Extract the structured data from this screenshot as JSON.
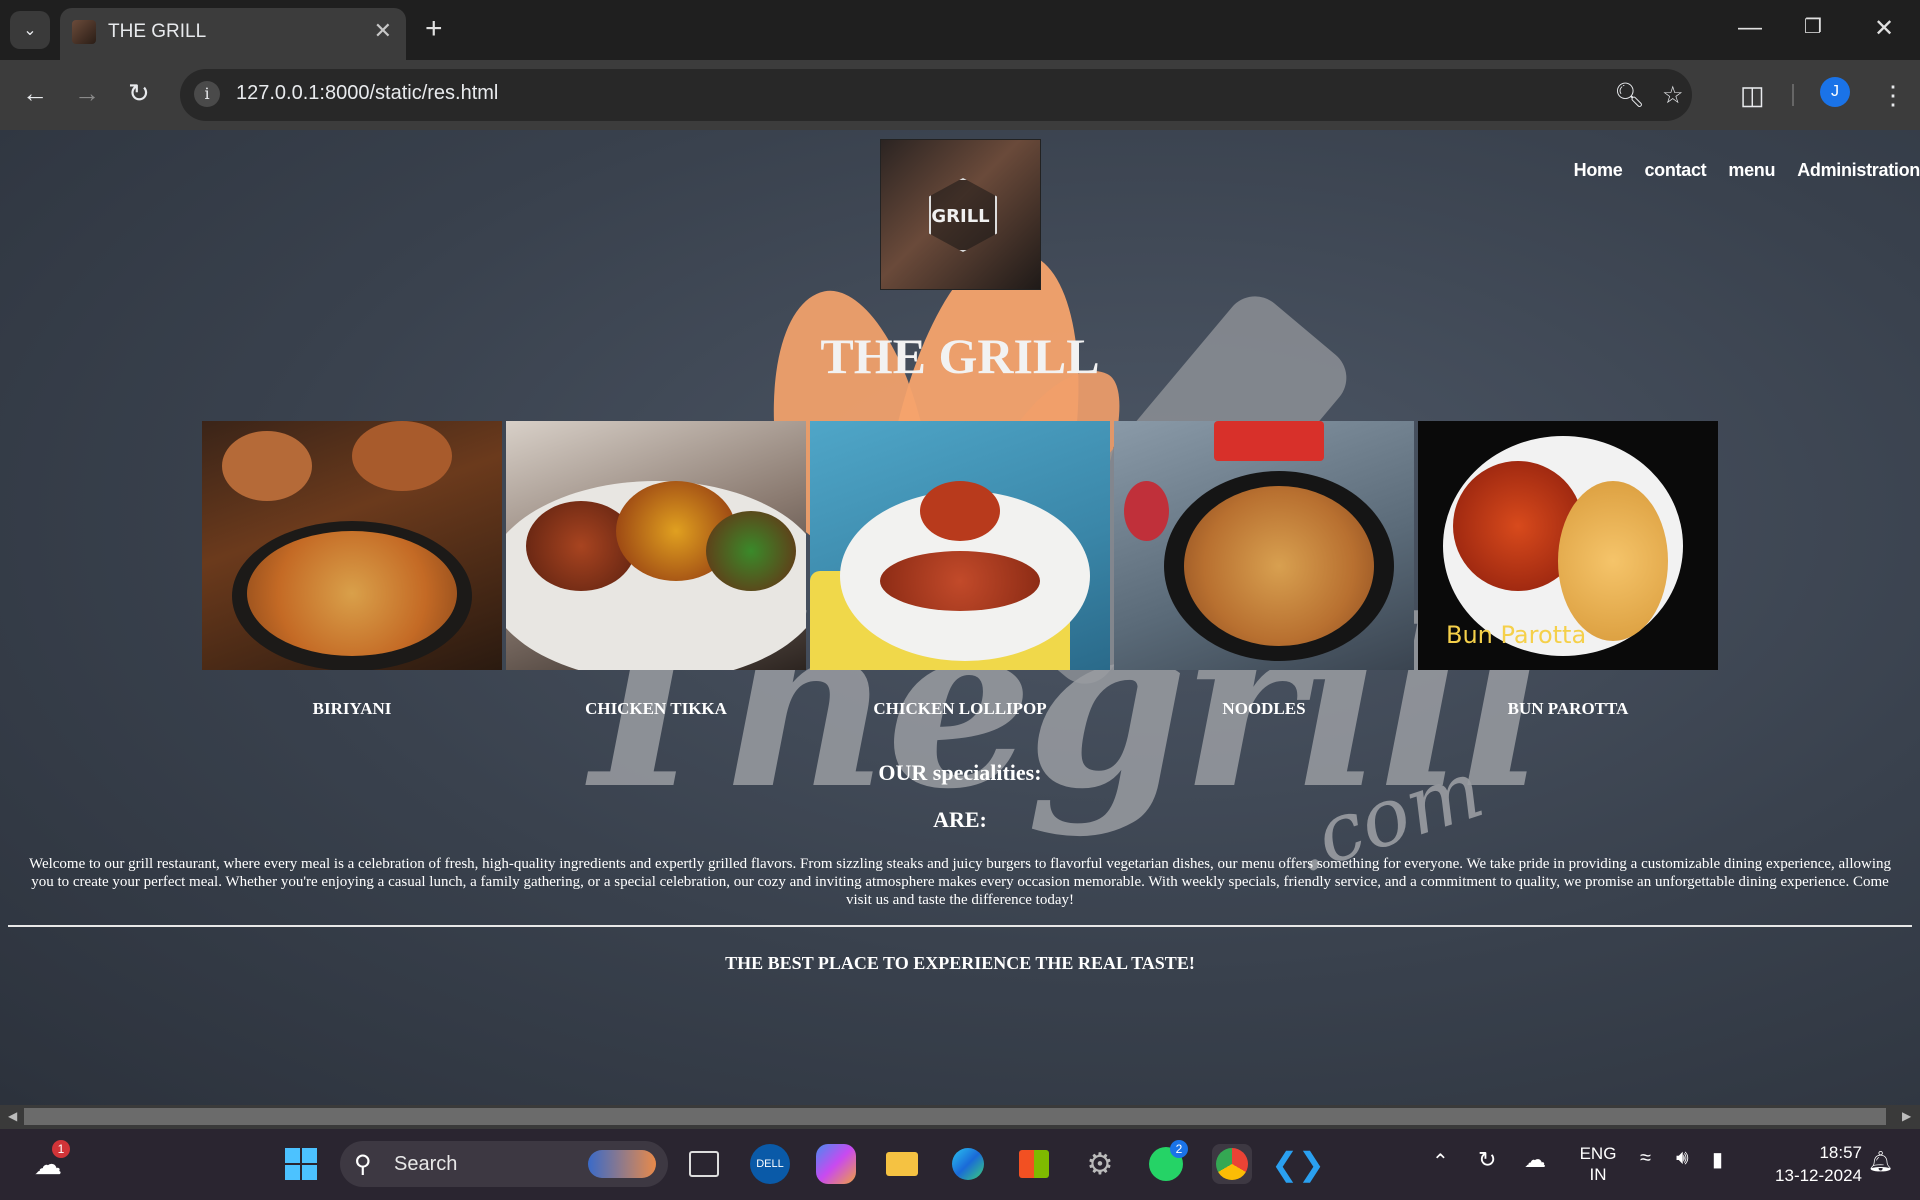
{
  "browser": {
    "tab_title": "THE GRILL",
    "url": "127.0.0.1:8000/static/res.html"
  },
  "site": {
    "logo_text": "GRILL",
    "nav": [
      "Home",
      "contact",
      "menu",
      "Administration"
    ],
    "title": "THE GRILL",
    "dishes": [
      {
        "name": "BIRIYANI",
        "icon": "biriyani-image"
      },
      {
        "name": "CHICKEN TIKKA",
        "icon": "chicken-tikka-image"
      },
      {
        "name": "CHICKEN LOLLIPOP",
        "icon": "chicken-lollipop-image"
      },
      {
        "name": "NOODLES",
        "icon": "noodles-image"
      },
      {
        "name": "BUN PAROTTA",
        "icon": "bun-parotta-image"
      }
    ],
    "bun_parotta_caption": "Bun Parotta",
    "specialities_line1": "OUR specialities:",
    "specialities_line2": "ARE:",
    "welcome_text": "Welcome to our grill restaurant, where every meal is a celebration of fresh, high-quality ingredients and expertly grilled flavors. From sizzling steaks and juicy burgers to flavorful vegetarian dishes, our menu offers something for everyone. We take pride in providing a customizable dining experience, allowing you to create your perfect meal. Whether you're enjoying a casual lunch, a family gathering, or a special celebration, our cozy and inviting atmosphere makes every occasion memorable. With weekly specials, friendly service, and a commitment to quality, we promise an unforgettable dining experience. Come visit us and taste the difference today!",
    "tagline": "THE BEST PLACE TO EXPERIENCE THE REAL TASTE!",
    "background_word": "Thegrill",
    "background_com": ".com"
  },
  "taskbar": {
    "search_placeholder": "Search",
    "weather_badge": "1",
    "whatsapp_badge": "2",
    "lang_top": "ENG",
    "lang_bottom": "IN",
    "time": "18:57",
    "date": "13-12-2024",
    "profile_initial": "J"
  },
  "colors": {
    "accent_flame": "#f5a36d",
    "chrome_dark": "#3c3c3c",
    "profile_blue": "#1a73e8"
  }
}
